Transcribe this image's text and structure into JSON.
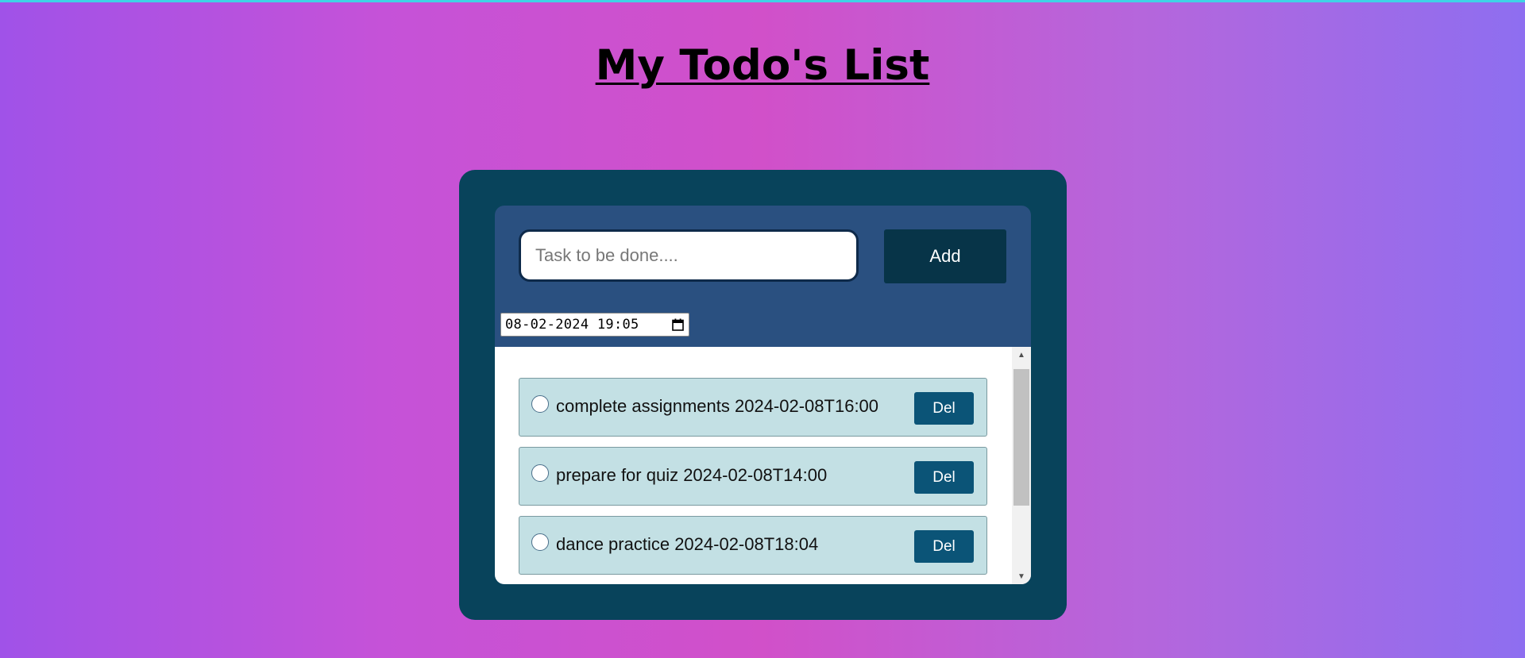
{
  "page": {
    "title": "My Todo's List"
  },
  "form": {
    "task_placeholder": "Task to be done....",
    "task_value": "",
    "add_label": "Add",
    "datetime_display": "08-02-2024 19:05"
  },
  "todos": [
    {
      "text": "complete assignments 2024-02-08T16:00",
      "checked": false,
      "delete_label": "Del"
    },
    {
      "text": "prepare for quiz 2024-02-08T14:00",
      "checked": false,
      "delete_label": "Del"
    },
    {
      "text": "dance practice 2024-02-08T18:04",
      "checked": false,
      "delete_label": "Del"
    }
  ],
  "colors": {
    "outer_card": "#08435b",
    "inner_card": "#2a5080",
    "add_button": "#073448",
    "todo_bg": "#c3e0e4",
    "del_button": "#0b5477",
    "top_accent": "#3fd3e6"
  },
  "icons": {
    "date_picker": "calendar-icon",
    "scroll_up": "triangle-up-icon",
    "scroll_down": "triangle-down-icon"
  }
}
